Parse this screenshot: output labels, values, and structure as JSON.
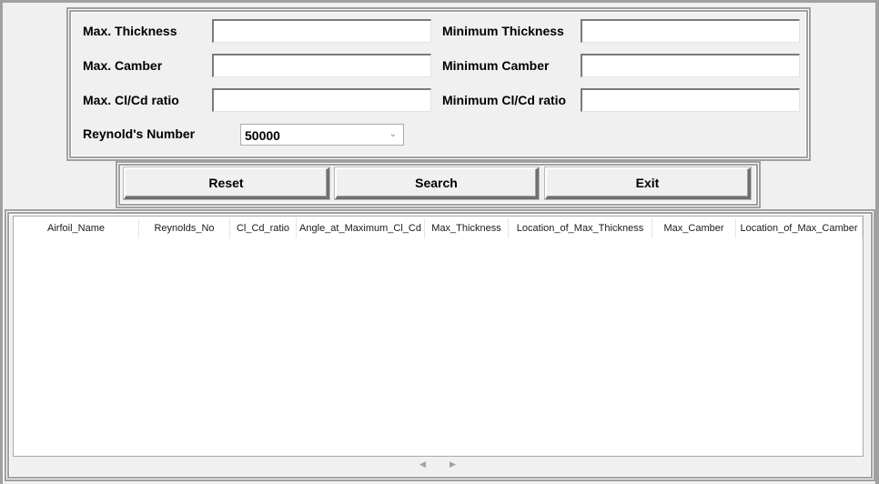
{
  "filters": {
    "max_thickness": {
      "label": "Max. Thickness",
      "value": ""
    },
    "min_thickness": {
      "label": "Minimum Thickness",
      "value": ""
    },
    "max_camber": {
      "label": "Max. Camber",
      "value": ""
    },
    "min_camber": {
      "label": "Minimum Camber",
      "value": ""
    },
    "max_clcd": {
      "label": "Max. Cl/Cd ratio",
      "value": ""
    },
    "min_clcd": {
      "label": "Minimum Cl/Cd ratio",
      "value": ""
    },
    "reynolds": {
      "label": "Reynold's Number",
      "selected": "50000",
      "icon": "chevron-down-icon"
    }
  },
  "buttons": {
    "reset": "Reset",
    "search": "Search",
    "exit": "Exit"
  },
  "table": {
    "columns": [
      "Airfoil_Name",
      "Reynolds_No",
      "Cl_Cd_ratio",
      "Angle_at_Maximum_Cl_Cd",
      "Max_Thickness",
      "Location_of_Max_Thickness",
      "Max_Camber",
      "Location_of_Max_Camber"
    ],
    "rows": []
  },
  "scrollbar": {
    "left_icon": "scroll-left-icon",
    "right_icon": "scroll-right-icon"
  }
}
